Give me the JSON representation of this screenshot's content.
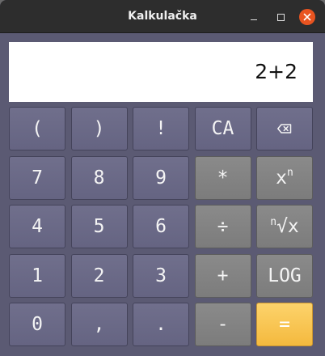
{
  "window": {
    "title": "Kalkulačka",
    "controls": {
      "minimize_icon": "minimize-icon",
      "maximize_icon": "maximize-icon",
      "close_icon": "close-icon",
      "close_color": "#e95420"
    }
  },
  "display": {
    "expression": "2+2"
  },
  "keypad": {
    "row1": {
      "open_paren": "(",
      "close_paren": ")",
      "factorial": "!",
      "clear_all": "CA",
      "backspace_icon": "backspace-icon"
    },
    "row2": {
      "seven": "7",
      "eight": "8",
      "nine": "9",
      "multiply": "*",
      "power_base": "x",
      "power_sup": "n"
    },
    "row3": {
      "four": "4",
      "five": "5",
      "six": "6",
      "divide": "÷",
      "root_sup": "n",
      "root_label": "√x"
    },
    "row4": {
      "one": "1",
      "two": "2",
      "three": "3",
      "plus": "+",
      "log": "LOG"
    },
    "row5": {
      "zero": "0",
      "comma": ",",
      "dot": ".",
      "minus": "-",
      "equals": "="
    }
  },
  "colors": {
    "window_bg": "#5b5a73",
    "key_bg": "#6b6a87",
    "operator_bg": "#838383",
    "equals_bg": "#f8c652",
    "titlebar_bg": "#2d2d2d"
  }
}
